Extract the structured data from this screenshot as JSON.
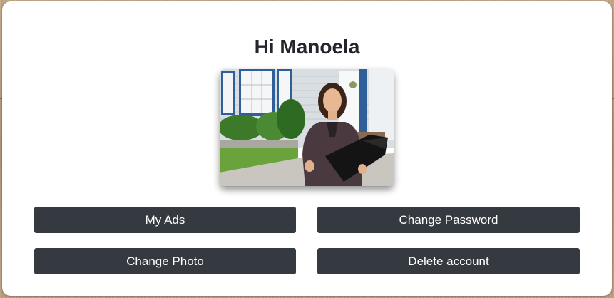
{
  "profile": {
    "greeting": "Hi Manoela",
    "photo_description": "avatar-photo"
  },
  "actions": {
    "my_ads": "My Ads",
    "change_password": "Change Password",
    "change_photo": "Change Photo",
    "delete_account": "Delete account"
  },
  "colors": {
    "button_bg": "#343a40",
    "button_text": "#ffffff",
    "heading": "#22252a",
    "modal_bg": "#ffffff"
  }
}
